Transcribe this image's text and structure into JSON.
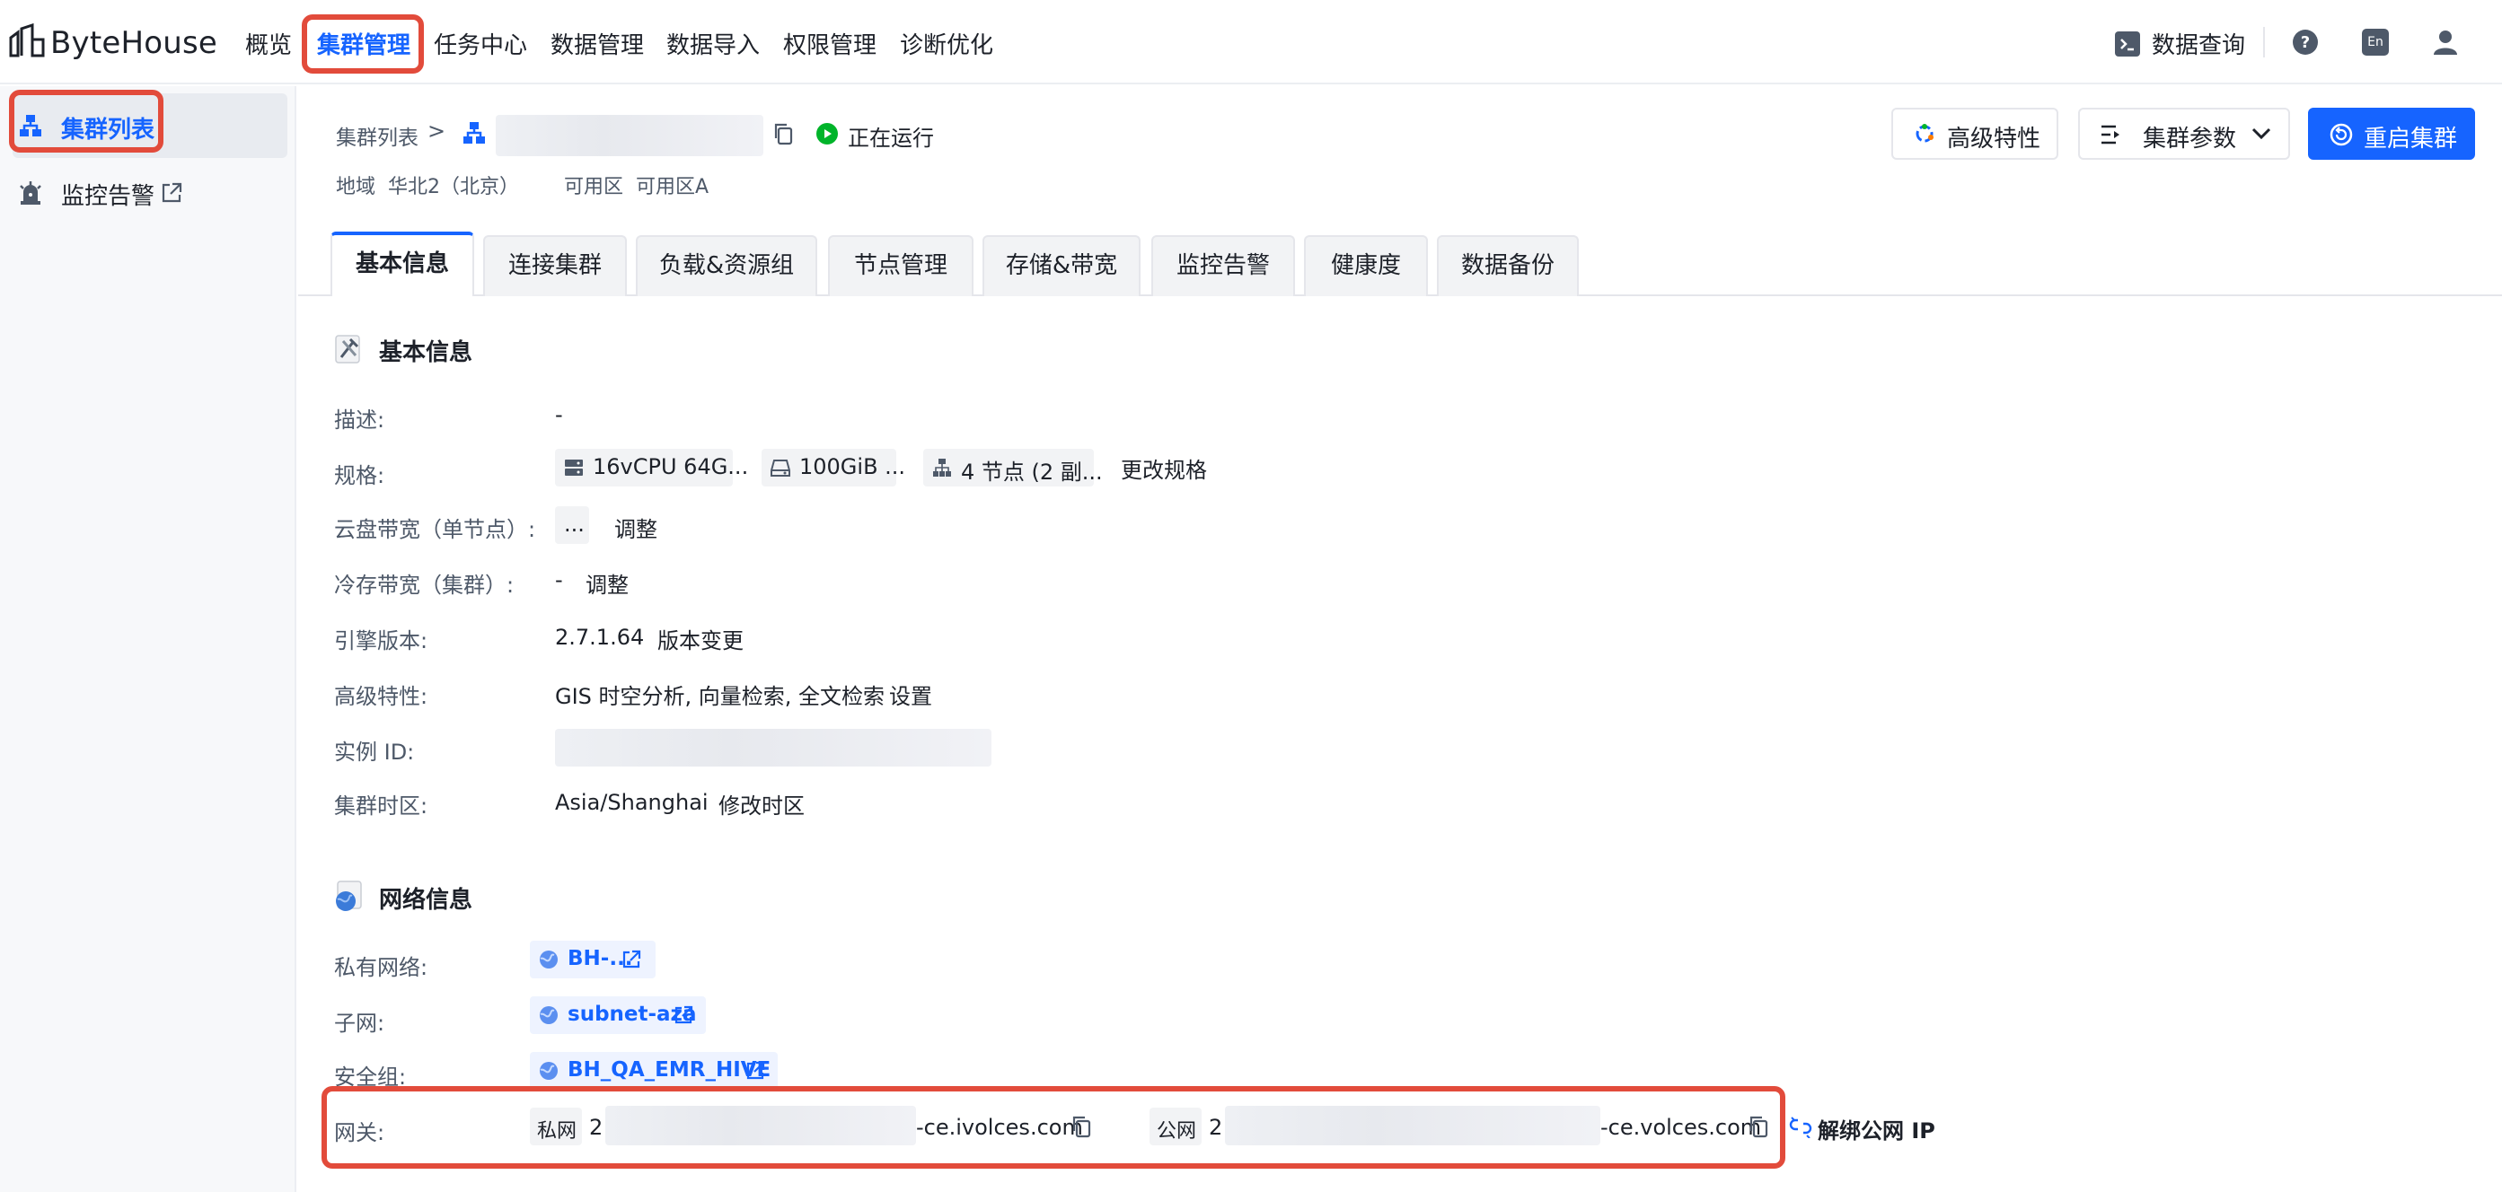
{
  "brand": {
    "name": "ByteHouse"
  },
  "topnav": {
    "items": [
      "概览",
      "集群管理",
      "任务中心",
      "数据管理",
      "数据导入",
      "权限管理",
      "诊断优化"
    ],
    "active_index": 1,
    "query_label": "数据查询",
    "help_icon": "question-circle-icon",
    "lang_badge": "En",
    "user_icon": "user-icon"
  },
  "sidebar": {
    "items": [
      {
        "label": "集群列表",
        "icon": "cluster-icon",
        "active": true
      },
      {
        "label": "监控告警",
        "icon": "alarm-icon",
        "external": true
      }
    ]
  },
  "header": {
    "breadcrumb_root": "集群列表",
    "breadcrumb_sep": ">",
    "status": "正在运行",
    "region_label": "地域",
    "region_value": "华北2（北京）",
    "zone_label": "可用区",
    "zone_value": "可用区A",
    "advanced_button": "高级特性",
    "params_button": "集群参数",
    "restart_button": "重启集群"
  },
  "tabs": [
    "基本信息",
    "连接集群",
    "负载&资源组",
    "节点管理",
    "存储&带宽",
    "监控告警",
    "健康度",
    "数据备份"
  ],
  "active_tab": 0,
  "basic": {
    "title": "基本信息",
    "desc_label": "描述:",
    "desc_value": "-",
    "spec_label": "规格:",
    "spec_cpu": "16vCPU 64G...",
    "spec_disk": "100GiB ...",
    "spec_nodes": "4 节点 (2 副...",
    "spec_link": "更改规格",
    "disk_bw_label": "云盘带宽（单节点）:",
    "disk_bw_value": "...",
    "disk_bw_link": "调整",
    "cold_bw_label": "冷存带宽（集群）:",
    "cold_bw_value": "-",
    "cold_bw_link": "调整",
    "engine_label": "引擎版本:",
    "engine_value": "2.7.1.64",
    "engine_link": "版本变更",
    "features_label": "高级特性:",
    "features_value": "GIS 时空分析, 向量检索, 全文检索",
    "features_link": "设置",
    "instance_label": "实例 ID:",
    "tz_label": "集群时区:",
    "tz_value": "Asia/Shanghai",
    "tz_link": "修改时区"
  },
  "network": {
    "title": "网络信息",
    "vpc_label": "私有网络:",
    "vpc_value": "BH-...",
    "subnet_label": "子网:",
    "subnet_value": "subnet-aza",
    "sg_label": "安全组:",
    "sg_value": "BH_QA_EMR_HIVE",
    "gw_label": "网关:",
    "private_tag": "私网",
    "private_prefix": "2",
    "private_suffix": "-ce.ivolces.com",
    "public_tag": "公网",
    "public_prefix": "2",
    "public_suffix": "-ce.volces.com",
    "unbind_link": "解绑公网 IP"
  },
  "colors": {
    "accent": "#1664ff",
    "running": "#00b42a",
    "highlight": "#e24b3b"
  }
}
